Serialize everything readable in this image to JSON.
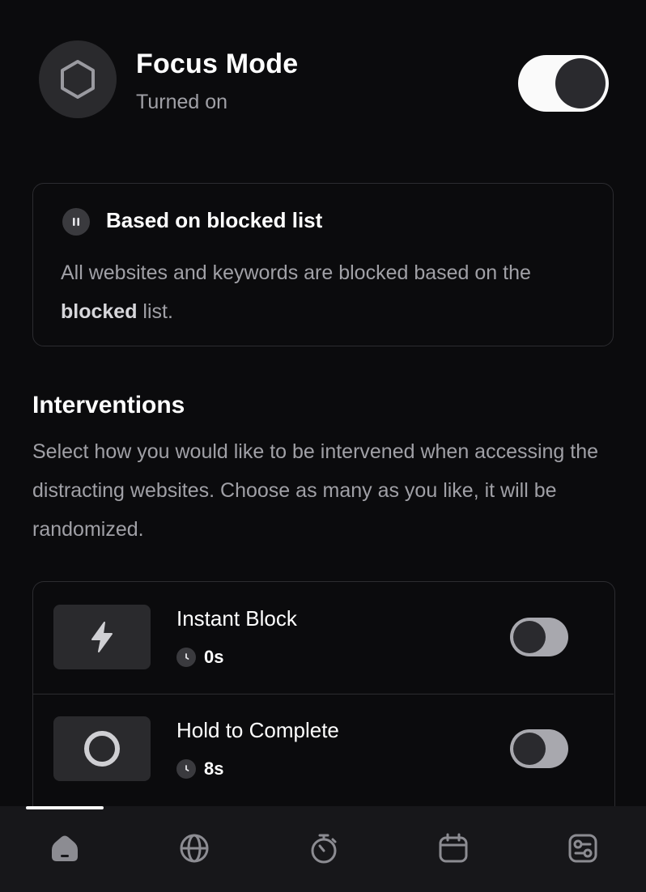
{
  "header": {
    "title": "Focus Mode",
    "status": "Turned on",
    "icon": "hexagon-icon",
    "toggle_on": true
  },
  "mode_card": {
    "title": "Based on blocked list",
    "icon": "pause-icon",
    "desc_before": "All websites and keywords are blocked based on the ",
    "desc_bold": "blocked",
    "desc_after": " list."
  },
  "interventions": {
    "title": "Interventions",
    "description": "Select how you would like to be intervened when accessing the distracting websites. Choose as many as you like, it will be randomized.",
    "items": [
      {
        "label": "Instant Block",
        "duration": "0s",
        "icon": "lightning-icon",
        "enabled": false
      },
      {
        "label": "Hold to Complete",
        "duration": "8s",
        "icon": "ring-icon",
        "enabled": false
      }
    ]
  },
  "bottom_nav": {
    "items": [
      {
        "icon": "home-icon",
        "active": true
      },
      {
        "icon": "globe-icon",
        "active": false
      },
      {
        "icon": "stopwatch-icon",
        "active": false
      },
      {
        "icon": "calendar-icon",
        "active": false
      },
      {
        "icon": "settings-icon",
        "active": false
      }
    ]
  },
  "colors": {
    "background": "#0b0b0d",
    "card_border": "#2c2c30",
    "muted_text": "#a0a0a6",
    "toggle_on_track": "#fafafa",
    "toggle_off_track": "#a8a8ae",
    "nav_background": "#17171a"
  }
}
